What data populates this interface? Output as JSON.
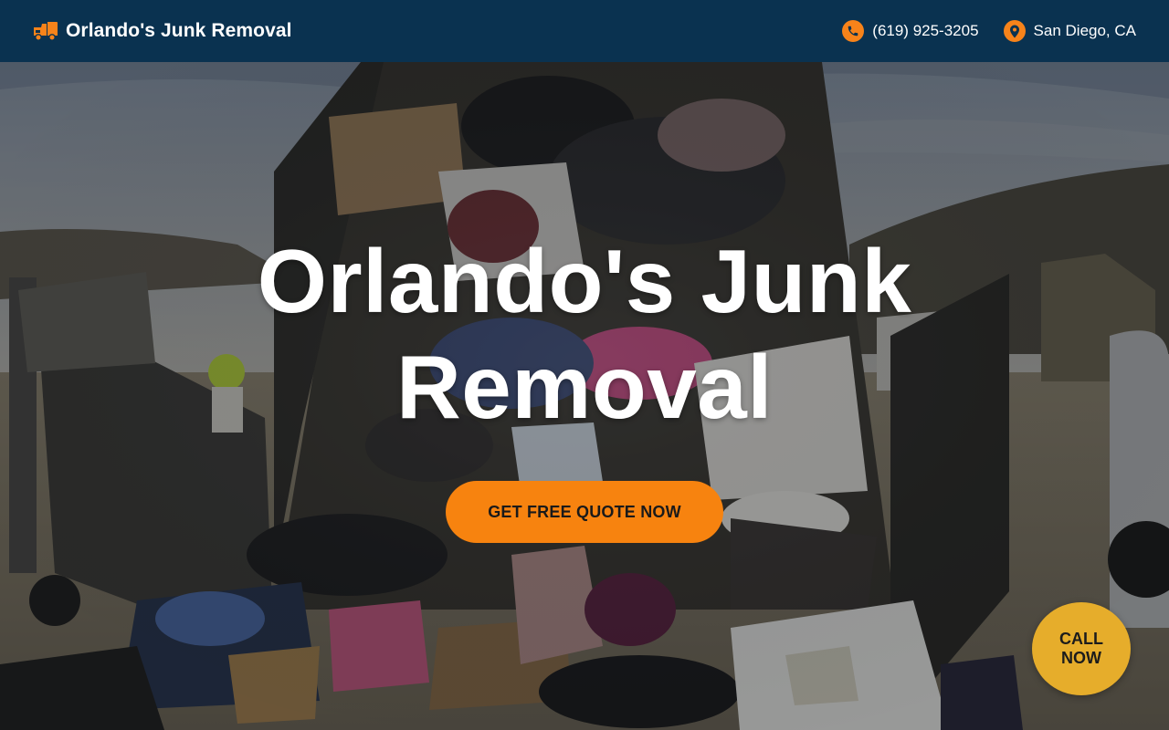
{
  "header": {
    "brand_name": "Orlando's Junk Removal",
    "brand_icon": "truck-icon",
    "phone": "(619) 925-3205",
    "phone_icon": "phone-icon",
    "location": "San Diego, CA",
    "location_icon": "map-pin-icon"
  },
  "hero": {
    "title_line1": "Orlando's Junk",
    "title_line2": "Removal",
    "cta_label": "GET FREE QUOTE NOW",
    "background": "junk-filled-dump-truck-photo"
  },
  "floating_call": {
    "line1": "CALL",
    "line2": "NOW"
  },
  "colors": {
    "header_bg": "#0a3250",
    "accent_orange": "#f7831a",
    "call_button": "#e6ad2b",
    "text_light": "#ffffff"
  }
}
